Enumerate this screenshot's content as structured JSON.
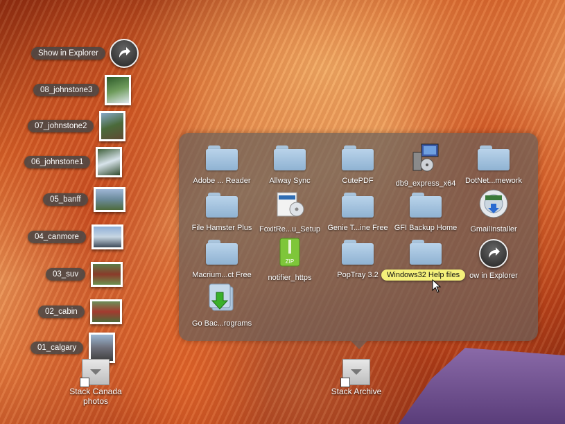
{
  "left_stack": {
    "show_label": "Show in Explorer",
    "items": [
      {
        "label": "08_johnstone3"
      },
      {
        "label": "07_johnstone2"
      },
      {
        "label": "06_johnstone1"
      },
      {
        "label": "05_banff"
      },
      {
        "label": "04_canmore"
      },
      {
        "label": "03_suv"
      },
      {
        "label": "02_cabin"
      },
      {
        "label": "01_calgary"
      }
    ]
  },
  "grid": {
    "items": [
      {
        "label": "Adobe ... Reader",
        "icon": "folder-icon"
      },
      {
        "label": "Allway Sync",
        "icon": "folder-icon"
      },
      {
        "label": "CutePDF",
        "icon": "folder-icon"
      },
      {
        "label": "db9_express_x64",
        "icon": "installer-icon"
      },
      {
        "label": "DotNet...mework",
        "icon": "folder-icon"
      },
      {
        "label": "File Hamster Plus",
        "icon": "folder-icon"
      },
      {
        "label": "FoxitRe...u_Setup",
        "icon": "software-box-icon"
      },
      {
        "label": "Genie T...ine Free",
        "icon": "folder-icon"
      },
      {
        "label": "GFI Backup Home",
        "icon": "folder-icon"
      },
      {
        "label": "GmailInstaller",
        "icon": "disc-installer-icon"
      },
      {
        "label": "Macrium...ct Free",
        "icon": "folder-icon"
      },
      {
        "label": "notifier_https",
        "icon": "zip-icon"
      },
      {
        "label": "PopTray 3.2",
        "icon": "folder-icon"
      },
      {
        "label": "Windows32 Help files",
        "icon": "folder-icon"
      },
      {
        "label": "ow in Explorer",
        "icon": "show-in-explorer-icon"
      },
      {
        "label": "Go Bac...rograms",
        "icon": "go-back-icon"
      }
    ],
    "tooltip": "Windows32 Help files"
  },
  "dock": {
    "stack1": "Stack Canada photos",
    "stack1_line1": "Stack Canada",
    "stack1_line2": "photos",
    "stack2": "Stack Archive"
  }
}
